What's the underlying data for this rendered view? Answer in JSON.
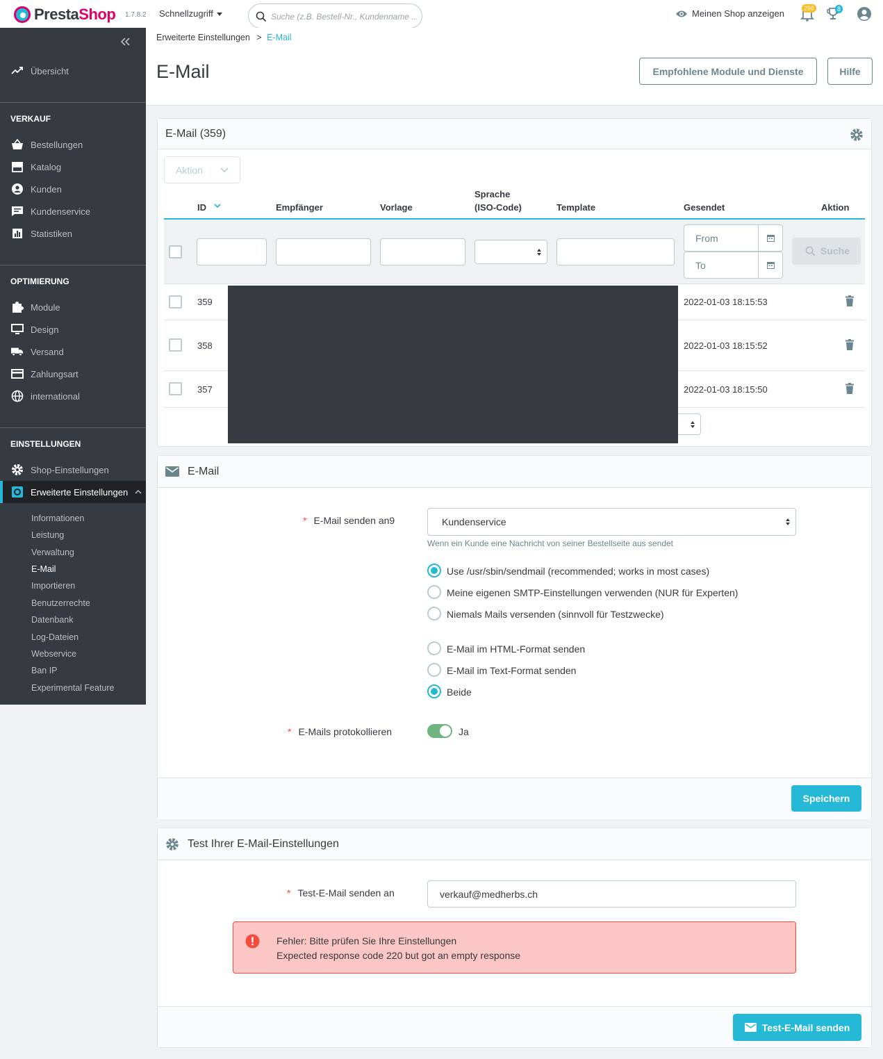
{
  "topbar": {
    "logo_part1": "Presta",
    "logo_part2": "Shop",
    "version": "1.7.8.2",
    "quick_access": "Schnellzugriff",
    "search_placeholder": "Suche (z.B. Bestell-Nr., Kundenname ...",
    "view_shop": "Meinen Shop anzeigen",
    "notif_orders": "296",
    "notif_customers": "8"
  },
  "sidebar": {
    "dashboard": "Übersicht",
    "sections": {
      "sell": "VERKAUF",
      "improve": "OPTIMIERUNG",
      "configure": "EINSTELLUNGEN"
    },
    "sell_items": [
      "Bestellungen",
      "Katalog",
      "Kunden",
      "Kundenservice",
      "Statistiken"
    ],
    "improve_items": [
      "Module",
      "Design",
      "Versand",
      "Zahlungsart",
      "international"
    ],
    "configure_items": [
      "Shop-Einstellungen",
      "Erweiterte Einstellungen"
    ],
    "sub_items": [
      "Informationen",
      "Leistung",
      "Verwaltung",
      "E-Mail",
      "Importieren",
      "Benutzerrechte",
      "Datenbank",
      "Log-Dateien",
      "Webservice",
      "Ban IP",
      "Experimental Feature"
    ]
  },
  "breadcrumb": {
    "parent": "Erweiterte Einstellungen",
    "sep": ">",
    "current": "E-Mail"
  },
  "page_title": "E-Mail",
  "header_buttons": {
    "modules": "Empfohlene Module und Dienste",
    "help": "Hilfe"
  },
  "list": {
    "title": "E-Mail (359)",
    "bulk_action": "Aktion",
    "columns": [
      "ID",
      "Empfänger",
      "Vorlage",
      "Sprache",
      "(ISO-Code)",
      "Template",
      "Gesendet",
      "Aktion"
    ],
    "filter_from": "From",
    "filter_to": "To",
    "search_btn": "Suche",
    "rows": [
      {
        "id": "359",
        "sent": "2022-01-03 18:15:53"
      },
      {
        "id": "358",
        "sent": "2022-01-03 18:15:52"
      },
      {
        "id": "357",
        "sent": "2022-01-03 18:15:50"
      }
    ]
  },
  "email_form": {
    "title": "E-Mail",
    "send_to_label": "E-Mail senden an9",
    "send_to_value": "Kundenservice",
    "send_to_help": "Wenn ein Kunde eine Nachricht von seiner Bestellseite aus sendet",
    "method_options": [
      "Use /usr/sbin/sendmail (recommended; works in most cases)",
      "Meine eigenen SMTP-Einstellungen verwenden (NUR für Experten)",
      "Niemals Mails versenden (sinnvoll für Testzwecke)"
    ],
    "format_options": [
      "E-Mail im HTML-Format senden",
      "E-Mail im Text-Format senden",
      "Beide"
    ],
    "log_label": "E-Mails protokollieren",
    "log_value": "Ja",
    "save": "Speichern"
  },
  "test_form": {
    "title": "Test Ihrer E-Mail-Einstellungen",
    "label": "Test-E-Mail senden an",
    "value": "verkauf@medherbs.ch",
    "error_title": "Fehler: Bitte prüfen Sie Ihre Einstellungen",
    "error_detail": "Expected response code 220 but got an empty response",
    "send": "Test-E-Mail senden"
  },
  "colors": {
    "accent": "#25b9d7",
    "brand": "#df0067",
    "sidebar": "#363a41",
    "error_bg": "#fbc6c3",
    "error": "#f54c3e"
  }
}
